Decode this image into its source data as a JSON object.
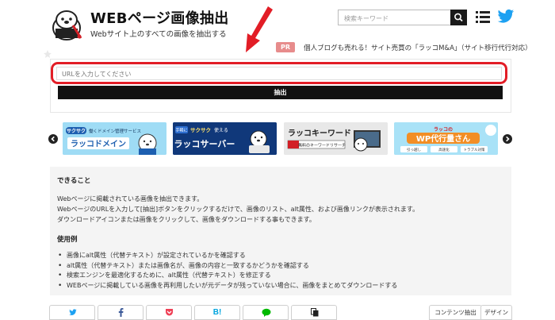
{
  "header": {
    "title": "WEBページ画像抽出",
    "subtitle": "Webサイト上のすべての画像を抽出する",
    "search_placeholder": "検索キーワード"
  },
  "ad": {
    "badge": "PR",
    "text": "個人ブログも売れる！サイト売買の「ラッコM&A」（サイト移行代行対応）"
  },
  "form": {
    "url_placeholder": "URLを入力してください",
    "extract_label": "抽出"
  },
  "banners": [
    {
      "tagline": "サクサク 働くドメイン管理サービス",
      "name": "ラッコドメイン",
      "bg": "#9fdcf5"
    },
    {
      "tagline": "手軽に サクサク 使える",
      "name": "ラッコサーバー",
      "bg": "#10387a"
    },
    {
      "tagline": "ラッコキーワード",
      "name": "無料のキーワードリサーチ",
      "bg": "#e8e8e8"
    },
    {
      "tagline": "ラッコの",
      "name": "WP代行量さん",
      "bg": "#a9e2f7",
      "tags": [
        "引っ越し",
        "高速化",
        "トラブル対策"
      ]
    }
  ],
  "info": {
    "about_heading": "できること",
    "about_lines": [
      "Webページに掲載されている画像を抽出できます。",
      "WebページのURLを入力して[抽出]ボタンをクリックするだけで、画像のリスト、alt属性、および画像リンクが表示されます。",
      "ダウンロードアイコンまたは画像をクリックして、画像をダウンロードする事もできます。"
    ],
    "usage_heading": "使用例",
    "usage_items": [
      "画像にalt属性（代替テキスト）が設定されているかを確認する",
      "alt属性（代替テキスト）または画像名が、画像の内容と一致するかどうかを確認する",
      "検索エンジンを最適化するために、alt属性（代替テキスト）を修正する",
      "WEBページに掲載している画像を再利用したいが元データが残っていない場合に、画像をまとめてダウンロードする"
    ]
  },
  "share": {
    "hatena_label": "B!"
  },
  "tags": [
    "コンテンツ抽出",
    "デザイン"
  ],
  "colors": {
    "highlight_red": "#e21d26",
    "twitter_blue": "#1da1f2",
    "facebook_blue": "#3b5998",
    "pocket_red": "#ef4056",
    "hatena_blue": "#00a4de",
    "line_green": "#00b900"
  }
}
